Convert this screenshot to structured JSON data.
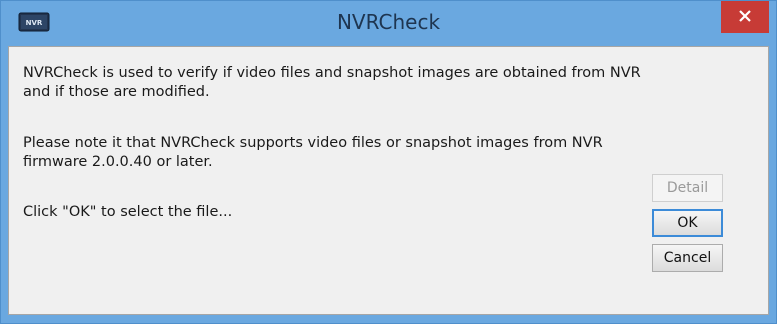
{
  "window": {
    "title": "NVRCheck",
    "app_icon": "nvr-icon",
    "close_icon": "close-icon"
  },
  "message": {
    "paragraph1": "NVRCheck is used to verify if video files and snapshot images are obtained from NVR and if those are modified.",
    "paragraph2": "Please note it that NVRCheck supports video files or snapshot images from NVR firmware 2.0.0.40 or later.",
    "paragraph3": "Click \"OK\" to select the file..."
  },
  "buttons": {
    "detail": "Detail",
    "ok": "OK",
    "cancel": "Cancel"
  },
  "colors": {
    "titlebar": "#6aa8e0",
    "close_button": "#c73b36",
    "dialog_background": "#f0f0f0"
  }
}
